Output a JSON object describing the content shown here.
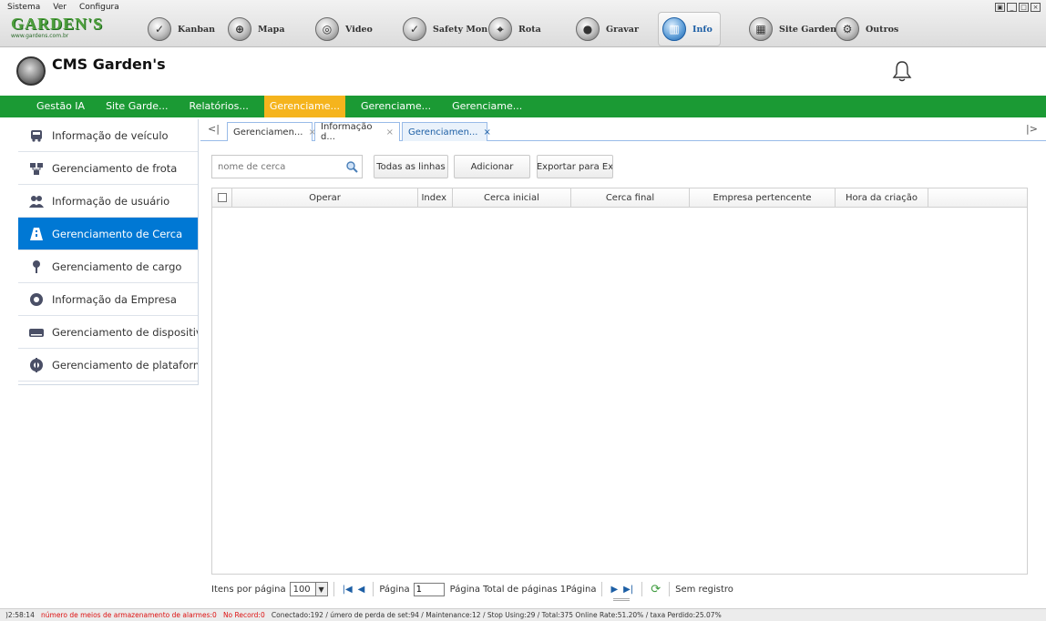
{
  "menu": [
    "Sistema",
    "Ver",
    "Configura"
  ],
  "brand": {
    "logo_text": "GARDEN'S",
    "logo_url": "www.gardens.com.br"
  },
  "modules": [
    {
      "label": "Kanban",
      "icon": "shield-icon"
    },
    {
      "label": "Mapa",
      "icon": "globe-icon"
    },
    {
      "label": "Video",
      "icon": "camera-icon"
    },
    {
      "label": "Safety Mon",
      "icon": "shield-icon"
    },
    {
      "label": "Rota",
      "icon": "route-icon"
    },
    {
      "label": "Gravar",
      "icon": "record-icon"
    },
    {
      "label": "Info",
      "icon": "chart-icon",
      "active": true
    },
    {
      "label": "Site Garden",
      "icon": "site-icon"
    },
    {
      "label": "Outros",
      "icon": "gear-icon"
    }
  ],
  "app": {
    "title": "CMS Garden's"
  },
  "nav": [
    "Gestão IA",
    "Site Garde...",
    "Relatórios...",
    "Gerenciame...",
    "Gerenciame...",
    "Gerenciame..."
  ],
  "nav_active_index": 3,
  "sidebar": [
    {
      "label": "Informação de veículo",
      "icon": "vehicle-icon"
    },
    {
      "label": "Gerenciamento de frota",
      "icon": "fleet-icon"
    },
    {
      "label": "Informação de usuário",
      "icon": "users-icon"
    },
    {
      "label": "Gerenciamento de Cerca",
      "icon": "fence-icon",
      "active": true
    },
    {
      "label": "Gerenciamento de cargo",
      "icon": "pin-icon"
    },
    {
      "label": "Informação da Empresa",
      "icon": "company-icon"
    },
    {
      "label": "Gerenciamento de dispositivo",
      "icon": "device-icon"
    },
    {
      "label": "Gerenciamento de plataforma",
      "icon": "platform-icon"
    }
  ],
  "tabs": {
    "prev": "<|",
    "next": "|>",
    "items": [
      {
        "label": "Gerenciamen...",
        "close": "×"
      },
      {
        "label": "Informação d...",
        "close": "×"
      },
      {
        "label": "Gerenciamen...",
        "close": "×",
        "active": true
      }
    ]
  },
  "toolbar": {
    "search_placeholder": "nome de cerca",
    "all_lines": "Todas as linhas",
    "add": "Adicionar",
    "export": "Exportar para Ex"
  },
  "grid": {
    "columns": [
      "Operar",
      "Index",
      "Cerca inicial",
      "Cerca final",
      "Empresa pertencente",
      "Hora da criação"
    ],
    "rows": []
  },
  "pager": {
    "items_per_page_label": "Itens por página",
    "page_size": "100",
    "page_label": "Página",
    "page_value": "1",
    "total_pages": "Página  Total de páginas 1Página",
    "no_records": "Sem registro"
  },
  "status": {
    "time": ")2:58:14",
    "alarm_storage": "número de meios de armazenamento de alarmes:0",
    "no_record": "No Record:0",
    "summary": "Conectado:192 / úmero de perda de set:94 / Maintenance:12 / Stop Using:29 / Total:375   Online Rate:51.20% / taxa Perdido:25.07%"
  },
  "colors": {
    "nav_green": "#1b9a34",
    "nav_active": "#f5b41d",
    "sidebar_active": "#0078d4",
    "status_red": "#dd1111"
  }
}
